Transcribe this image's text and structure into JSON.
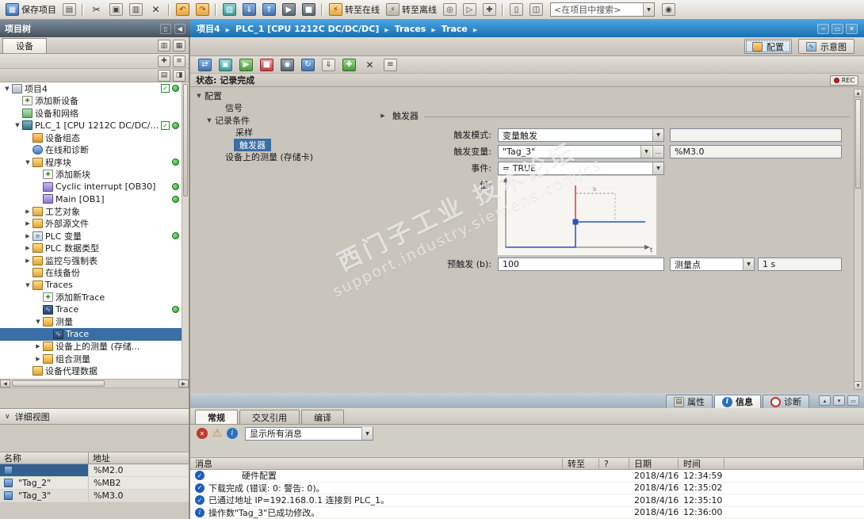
{
  "window": {
    "min": "─",
    "restore": "▭",
    "close": "✕"
  },
  "top_toolbar": {
    "buttons_left": [
      {
        "name": "save-project-button",
        "g": "▦",
        "cls": "blue",
        "label": "保存项目"
      },
      {
        "name": "print-button",
        "g": "▤",
        "cls": "gray"
      },
      {
        "name": "toolbar-separator",
        "cls": "sep"
      },
      {
        "name": "cut-button",
        "g": "✂",
        "cls": "plain"
      },
      {
        "name": "copy-button",
        "g": "▣",
        "cls": "gray"
      },
      {
        "name": "paste-button",
        "g": "▥",
        "cls": "gray"
      },
      {
        "name": "delete-button",
        "g": "✕",
        "cls": "plain"
      },
      {
        "name": "toolbar-separator",
        "cls": "sep"
      },
      {
        "name": "undo-button",
        "g": "↶",
        "cls": "amber"
      },
      {
        "name": "redo-button",
        "g": "↷",
        "cls": "amber"
      },
      {
        "name": "toolbar-separator",
        "cls": "sep"
      },
      {
        "name": "compile-button",
        "g": "▨",
        "cls": "teal"
      },
      {
        "name": "download-to-device-button",
        "g": "⇓",
        "cls": "blue"
      },
      {
        "name": "upload-from-device-button",
        "g": "⇑",
        "cls": "blue"
      },
      {
        "name": "start-cpu-button",
        "g": "▶",
        "cls": "dark"
      },
      {
        "name": "stop-cpu-button",
        "g": "■",
        "cls": "dark"
      },
      {
        "name": "toolbar-separator",
        "cls": "sep"
      },
      {
        "name": "go-online-button",
        "g": "⚡",
        "cls": "gonline",
        "label": "转至在线"
      },
      {
        "name": "go-offline-button",
        "g": "⚡",
        "cls": "goffline",
        "label": "转至离线"
      },
      {
        "name": "online-diagnostics-button",
        "g": "◎",
        "cls": "gray"
      },
      {
        "name": "simulation-button",
        "g": "▷",
        "cls": "gray"
      },
      {
        "name": "cross-reference-button",
        "g": "✚",
        "cls": "gray"
      },
      {
        "name": "toolbar-separator",
        "cls": "sep"
      },
      {
        "name": "split-editor-button",
        "g": "▯",
        "cls": "gray"
      },
      {
        "name": "window-layout-button",
        "g": "◫",
        "cls": "gray"
      }
    ],
    "search_value": "<在项目中搜索>",
    "buttons_right": [
      {
        "name": "search-project-button",
        "g": "◉",
        "cls": "gray"
      }
    ]
  },
  "breadcrumb": {
    "items": [
      {
        "label": "项目4"
      },
      {
        "label": "PLC_1 [CPU 1212C DC/DC/DC]"
      },
      {
        "label": "Traces"
      },
      {
        "label": "Trace"
      }
    ]
  },
  "project_tree": {
    "title": "项目树",
    "tab": "设备",
    "items": [
      {
        "label": "项目4",
        "tw": "▼",
        "icon": "project",
        "pad": 4,
        "cls": "has-chk has-dot"
      },
      {
        "label": "添加新设备",
        "icon": "add-device",
        "pad": 17
      },
      {
        "label": "设备和网络",
        "icon": "devices-networks",
        "pad": 17
      },
      {
        "label": "PLC_1 [CPU 1212C DC/DC/DC]",
        "tw": "▼",
        "icon": "plc",
        "pad": 17,
        "cls": "has-chk has-dot"
      },
      {
        "label": "设备组态",
        "icon": "device-config",
        "pad": 30
      },
      {
        "label": "在线和诊断",
        "icon": "online-diagnostics",
        "pad": 30
      },
      {
        "label": "程序块",
        "tw": "▼",
        "icon": "blocks-folder",
        "pad": 30,
        "cls": "has-dot"
      },
      {
        "label": "添加新块",
        "icon": "add-block",
        "pad": 43
      },
      {
        "label": "Cyclic interrupt [OB30]",
        "icon": "ob-block",
        "pad": 43,
        "cls": "has-dot"
      },
      {
        "label": "Main [OB1]",
        "icon": "ob-block",
        "pad": 43,
        "cls": "has-dot"
      },
      {
        "label": "工艺对象",
        "tw": "▶",
        "icon": "tech-objects-folder",
        "pad": 30
      },
      {
        "label": "外部源文件",
        "tw": "▶",
        "icon": "sources-folder",
        "pad": 30
      },
      {
        "label": "PLC 变量",
        "tw": "▶",
        "icon": "plc-tags",
        "pad": 30,
        "cls": "has-dot"
      },
      {
        "label": "PLC 数据类型",
        "tw": "▶",
        "icon": "data-types-folder",
        "pad": 30
      },
      {
        "label": "监控与强制表",
        "tw": "▶",
        "icon": "watch-tables-folder",
        "pad": 30
      },
      {
        "label": "在线备份",
        "icon": "backups-folder",
        "pad": 30
      },
      {
        "label": "Traces",
        "tw": "▼",
        "icon": "traces-folder",
        "pad": 30
      },
      {
        "label": "添加新Trace",
        "icon": "add-trace",
        "pad": 43
      },
      {
        "label": "Trace",
        "icon": "trace",
        "pad": 43,
        "cls": "has-dot"
      },
      {
        "label": "测量",
        "tw": "▼",
        "icon": "measurements-folder",
        "pad": 43
      },
      {
        "label": "Trace",
        "icon": "trace",
        "pad": 56,
        "cls": "sel"
      },
      {
        "label": "设备上的测量 (存储...",
        "tw": "▶",
        "icon": "device-measurements-folder",
        "pad": 43
      },
      {
        "label": "组合测量",
        "tw": "▶",
        "icon": "combined-measurements-folder",
        "pad": 43
      },
      {
        "label": "设备代理数据",
        "icon": "proxy-data-folder",
        "pad": 30
      }
    ]
  },
  "detail_view": {
    "title": "详细视图",
    "columns": [
      "名称",
      "地址"
    ],
    "rows": [
      {
        "icon": "detail-tag",
        "name": "",
        "addr": "%M2.0",
        "cls": "sel"
      },
      {
        "icon": "detail-tag",
        "name": "\"Tag_2\"",
        "addr": "%MB2"
      },
      {
        "icon": "detail-tag",
        "name": "\"Tag_3\"",
        "addr": "%M3.0",
        "cls": "alt"
      }
    ]
  },
  "trace_view": {
    "view_buttons": [
      {
        "name": "configuration-view-button",
        "label": "配置",
        "icon": "config-view",
        "cls": "active"
      },
      {
        "name": "diagram-view-button",
        "label": "示意图",
        "icon": "diagram-view"
      }
    ],
    "toolbar": [
      {
        "name": "transfer-config-to-device-button",
        "g": "⇄",
        "cls": "blue"
      },
      {
        "name": "monitor-onoff-button",
        "g": "▣",
        "cls": "teal"
      },
      {
        "name": "start-recording-button",
        "g": "▶",
        "cls": "green"
      },
      {
        "name": "stop-recording-button",
        "g": "■",
        "cls": "red"
      },
      {
        "name": "snapshot-button",
        "g": "◉",
        "cls": "dark"
      },
      {
        "name": "repeat-measurement-button",
        "g": "↻",
        "cls": "blue"
      },
      {
        "name": "export-measurement-button",
        "g": "⇓",
        "cls": "gray"
      },
      {
        "name": "add-measurement-button",
        "g": "✚",
        "cls": "green"
      },
      {
        "name": "delete-measurement-button",
        "g": "✕",
        "cls": "plain"
      },
      {
        "name": "trace-settings-button",
        "g": "≡",
        "cls": "gray"
      }
    ],
    "status": "状态: 记录完成",
    "rec": "REC",
    "config_tree": [
      {
        "label": "配置",
        "tw": "▼",
        "pad": 4
      },
      {
        "label": "信号",
        "pad": 30
      },
      {
        "label": "记录条件",
        "tw": "▼",
        "pad": 17
      },
      {
        "label": "采样",
        "pad": 43
      },
      {
        "label": "触发器",
        "pad": 43,
        "cls": "sel"
      },
      {
        "label": "设备上的测量 (存储卡)",
        "pad": 30
      }
    ],
    "trigger": {
      "section": "触发器",
      "mode_label": "触发模式:",
      "mode_value": "变量触发",
      "var_label": "触发变量:",
      "var_value": "\"Tag_3\"",
      "var_addr": "%M3.0",
      "event_label": "事件:",
      "event_value": "= TRUE",
      "value_label": "值:",
      "axis_t": "t",
      "annotation_b": "b",
      "pre_label": "预触发 (b):",
      "pre_value": "100",
      "pre_unit": "测量点",
      "pre_time": "1 s"
    }
  },
  "inspector": {
    "tabs": [
      {
        "name": "tab-properties",
        "label": "属性",
        "icon": "properties"
      },
      {
        "name": "tab-info",
        "label": "信息",
        "icon": "info-tab",
        "cls": "active"
      },
      {
        "name": "tab-diagnostics",
        "label": "诊断",
        "icon": "diagnostics"
      }
    ],
    "subtabs": [
      {
        "name": "subtab-general",
        "label": "常规",
        "cls": "active"
      },
      {
        "name": "subtab-cross-references",
        "label": "交叉引用"
      },
      {
        "name": "subtab-compile",
        "label": "编译"
      }
    ],
    "filter_value": "显示所有消息",
    "columns": [
      {
        "label": "消息",
        "cls": "c-msg"
      },
      {
        "label": "转至",
        "cls": "c-goto"
      },
      {
        "label": "?",
        "cls": "c-q"
      },
      {
        "label": "日期",
        "cls": "c-date"
      },
      {
        "label": "时间",
        "cls": "c-time"
      },
      {
        "label": "",
        "cls": "c-fill"
      }
    ],
    "messages": [
      {
        "icon": "check",
        "text": "硬件配置",
        "cls": "indent",
        "date": "2018/4/16",
        "time": "12:34:59"
      },
      {
        "icon": "check",
        "text": "下载完成 (错误: 0: 警告: 0)。",
        "date": "2018/4/16",
        "time": "12:35:02"
      },
      {
        "icon": "check",
        "text": "已通过地址 IP=192.168.0.1 连接到 PLC_1。",
        "date": "2018/4/16",
        "time": "12:35:10"
      },
      {
        "icon": "info",
        "text": "操作数\"Tag_3\"已成功修改。",
        "date": "2018/4/16",
        "time": "12:36:00"
      }
    ]
  },
  "watermark": {
    "line1": "西门子工业 技术论坛",
    "line2": "support.industry.siemens.com/cs"
  }
}
